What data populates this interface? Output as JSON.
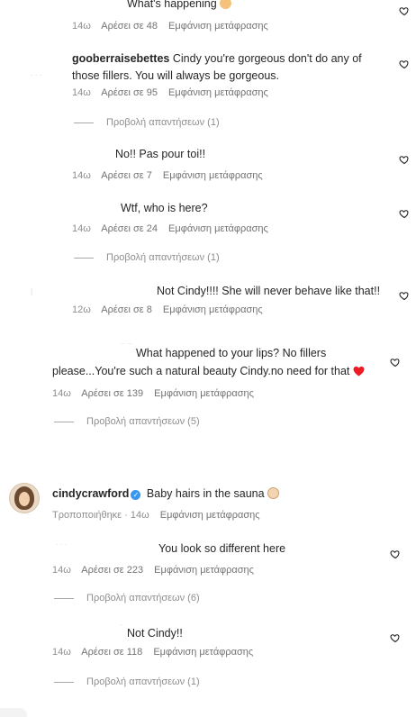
{
  "comments": [
    {
      "id": "c0",
      "text": "What's happening",
      "emoji_icon": "woman-shrugging-emoji",
      "time": "14ω",
      "likes": "Αρέσει σε 48",
      "translate": "Εμφάνιση μετάφρασης"
    },
    {
      "id": "c1",
      "username": "gooberraisebettes",
      "text": "Cindy you're gorgeous don't do any of those fillers. You will always be gorgeous.",
      "time": "14ω",
      "likes": "Αρέσει σε 95",
      "translate": "Εμφάνιση μετάφρασης",
      "replies": "Προβολή απαντήσεων (1)"
    },
    {
      "id": "c2",
      "text": "No!! Pas pour toi!!",
      "time": "14ω",
      "likes": "Αρέσει σε 7",
      "translate": "Εμφάνιση μετάφρασης"
    },
    {
      "id": "c3",
      "text": "Wtf, who is here?",
      "time": "14ω",
      "likes": "Αρέσει σε 24",
      "translate": "Εμφάνιση μετάφρασης",
      "replies": "Προβολή απαντήσεων (1)"
    },
    {
      "id": "c4",
      "text": "Not Cindy!!!! She will never behave like that!!",
      "time": "12ω",
      "likes": "Αρέσει σε 8",
      "translate": "Εμφάνιση μετάφρασης"
    },
    {
      "id": "c5",
      "text_line1": "What happened to your lips? No fillers",
      "text_line2": "please...You're such a natural beauty Cindy.no need for that",
      "emoji_icon": "red-heart-emoji",
      "time": "14ω",
      "likes": "Αρέσει σε 139",
      "translate": "Εμφάνιση μετάφρασης",
      "replies": "Προβολή απαντήσεων (5)"
    }
  ],
  "post": {
    "username": "cindycrawford",
    "verified_icon": "verified-badge-icon",
    "caption": "Baby hairs in the sauna",
    "caption_emoji": "baby-emoji",
    "edited": "Τροποποιήθηκε · 14ω",
    "translate": "Εμφάνιση μετάφρασης"
  },
  "post_replies": [
    {
      "id": "r1",
      "text": "You look so different here",
      "time": "14ω",
      "likes": "Αρέσει σε 223",
      "translate": "Εμφάνιση μετάφρασης",
      "replies": "Προβολή απαντήσεων (6)"
    },
    {
      "id": "r2",
      "text": "Not Cindy!!",
      "time": "14ω",
      "likes": "Αρέσει σε 118",
      "translate": "Εμφάνιση μετάφρασης",
      "replies": "Προβολή απαντήσεων (1)"
    }
  ],
  "colors": {
    "text": "#262626",
    "meta": "#8e8e8e",
    "verified": "#3897f0",
    "heart_emoji": "#ed1c24"
  }
}
